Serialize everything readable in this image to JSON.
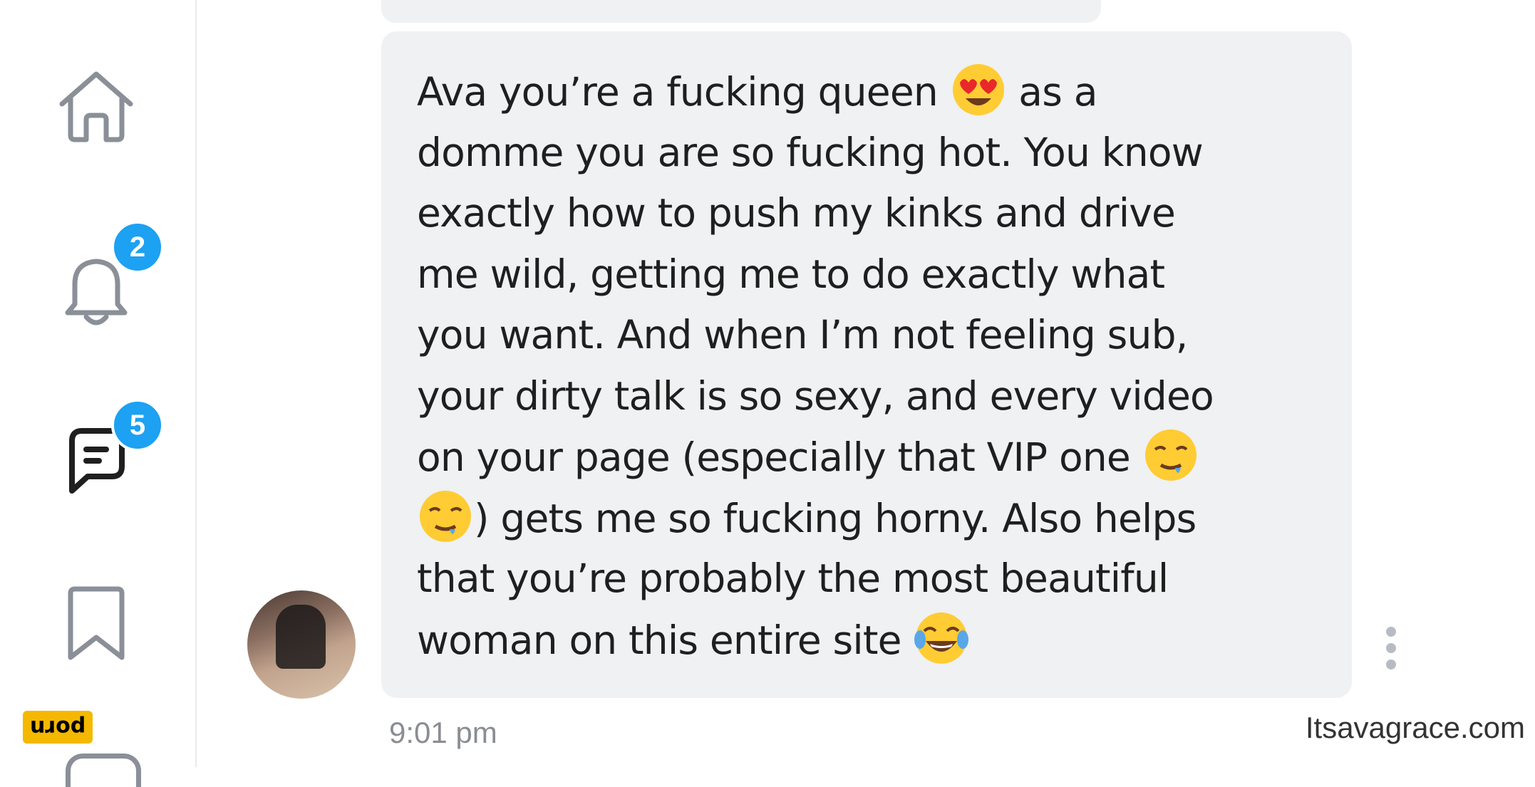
{
  "nav": {
    "items": [
      {
        "name": "home",
        "icon": "home-icon"
      },
      {
        "name": "notifications",
        "icon": "bell-icon",
        "badge": "2"
      },
      {
        "name": "messages",
        "icon": "message-icon",
        "badge": "5"
      },
      {
        "name": "bookmarks",
        "icon": "bookmark-icon"
      }
    ],
    "badge_color": "#1da1f2",
    "icon_color": "#8a8f98",
    "active_icon_color": "#1f1f1f"
  },
  "watermark_logo": "porn",
  "message": {
    "lines": [
      "Ava you’re a fucking queen ",
      " as a",
      "domme you are so fucking hot. You know",
      "exactly how to push my kinks and drive",
      "me wild, getting me to do exactly what",
      "you want. And when I’m not feeling sub,",
      "your dirty talk is so sexy, and every video",
      "on your page (especially that VIP one ",
      ") gets me so fucking horny. Also helps",
      "that you’re probably the most beautiful",
      "woman on this entire site "
    ],
    "emojis": [
      "heart-eyes-emoji",
      "drooling-face-emoji",
      "drooling-face-emoji",
      "tears-of-joy-emoji"
    ],
    "bubble_color": "#eff1f3",
    "time": "9:01 pm"
  },
  "watermark_site": "Itsavagrace.com"
}
